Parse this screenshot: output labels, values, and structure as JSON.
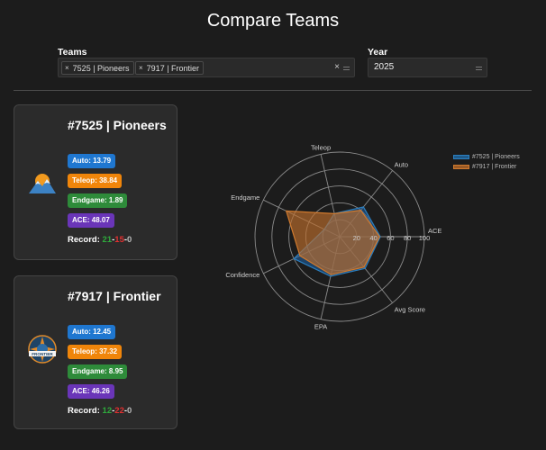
{
  "page": {
    "title": "Compare Teams"
  },
  "filters": {
    "teams_label": "Teams",
    "selected_teams": [
      "7525 | Pioneers",
      "7917 | Frontier"
    ],
    "chip_remove": "×",
    "clear_symbol": "×",
    "year_label": "Year",
    "year_value": "2025"
  },
  "teams": [
    {
      "name": "#7525 | Pioneers",
      "logo_icon": "mountain-sun-icon",
      "auto": "Auto: 13.79",
      "teleop": "Teleop: 38.84",
      "endgame": "Endgame: 1.89",
      "ace": "ACE: 48.07",
      "record_label": "Record: ",
      "wins": "21",
      "losses": "15",
      "ties": "0",
      "sep": "-"
    },
    {
      "name": "#7917 | Frontier",
      "logo_icon": "frontier-compass-icon",
      "logo_text": "FRONTIER",
      "auto": "Auto: 12.45",
      "teleop": "Teleop: 37.32",
      "endgame": "Endgame: 8.95",
      "ace": "ACE: 46.26",
      "record_label": "Record: ",
      "wins": "12",
      "losses": "22",
      "ties": "0",
      "sep": "-"
    }
  ],
  "chart_data": {
    "type": "radar",
    "axes": [
      "ACE",
      "Auto",
      "Teleop",
      "Endgame",
      "Confidence",
      "EPA",
      "Avg Score"
    ],
    "radial_ticks": [
      "0",
      "20",
      "40",
      "60",
      "80",
      "100"
    ],
    "range": [
      0,
      100
    ],
    "legend_placement": "top-right",
    "series": [
      {
        "name": "#7525 | Pioneers",
        "color": "#1f77b4",
        "values": [
          48,
          45,
          28,
          20,
          60,
          48,
          48
        ]
      },
      {
        "name": "#7917 | Frontier",
        "color": "#ff7f0e",
        "values": [
          47,
          40,
          28,
          70,
          52,
          46,
          46
        ]
      }
    ]
  }
}
